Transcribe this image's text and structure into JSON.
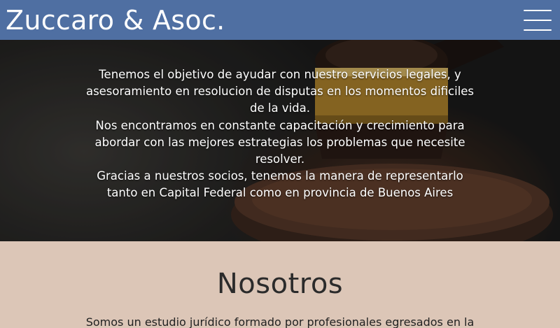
{
  "header": {
    "brand": "Zuccaro & Asoc.",
    "menu_icon": "hamburger-menu-icon"
  },
  "hero": {
    "lines": [
      "Tenemos el objetivo de ayudar con nuestro servicios legales, y",
      "asesoramiento en resolucion de disputas en los momentos dificiles",
      "de la vida.",
      "Nos encontramos en constante capacitación y crecimiento para",
      "abordar con las mejores estrategias los problemas que necesite",
      "resolver.",
      "Gracias a nuestros socios, tenemos la manera de representarlo",
      "tanto en Capital Federal como en provincia de Buenos Aires"
    ]
  },
  "about": {
    "title": "Nosotros",
    "text": "Somos un estudio jurídico formado por profesionales egresados en la"
  },
  "colors": {
    "navbar": "#4f6fa2",
    "section_bg": "#dcc6b7",
    "gavel_brass": "#c79a3c"
  }
}
